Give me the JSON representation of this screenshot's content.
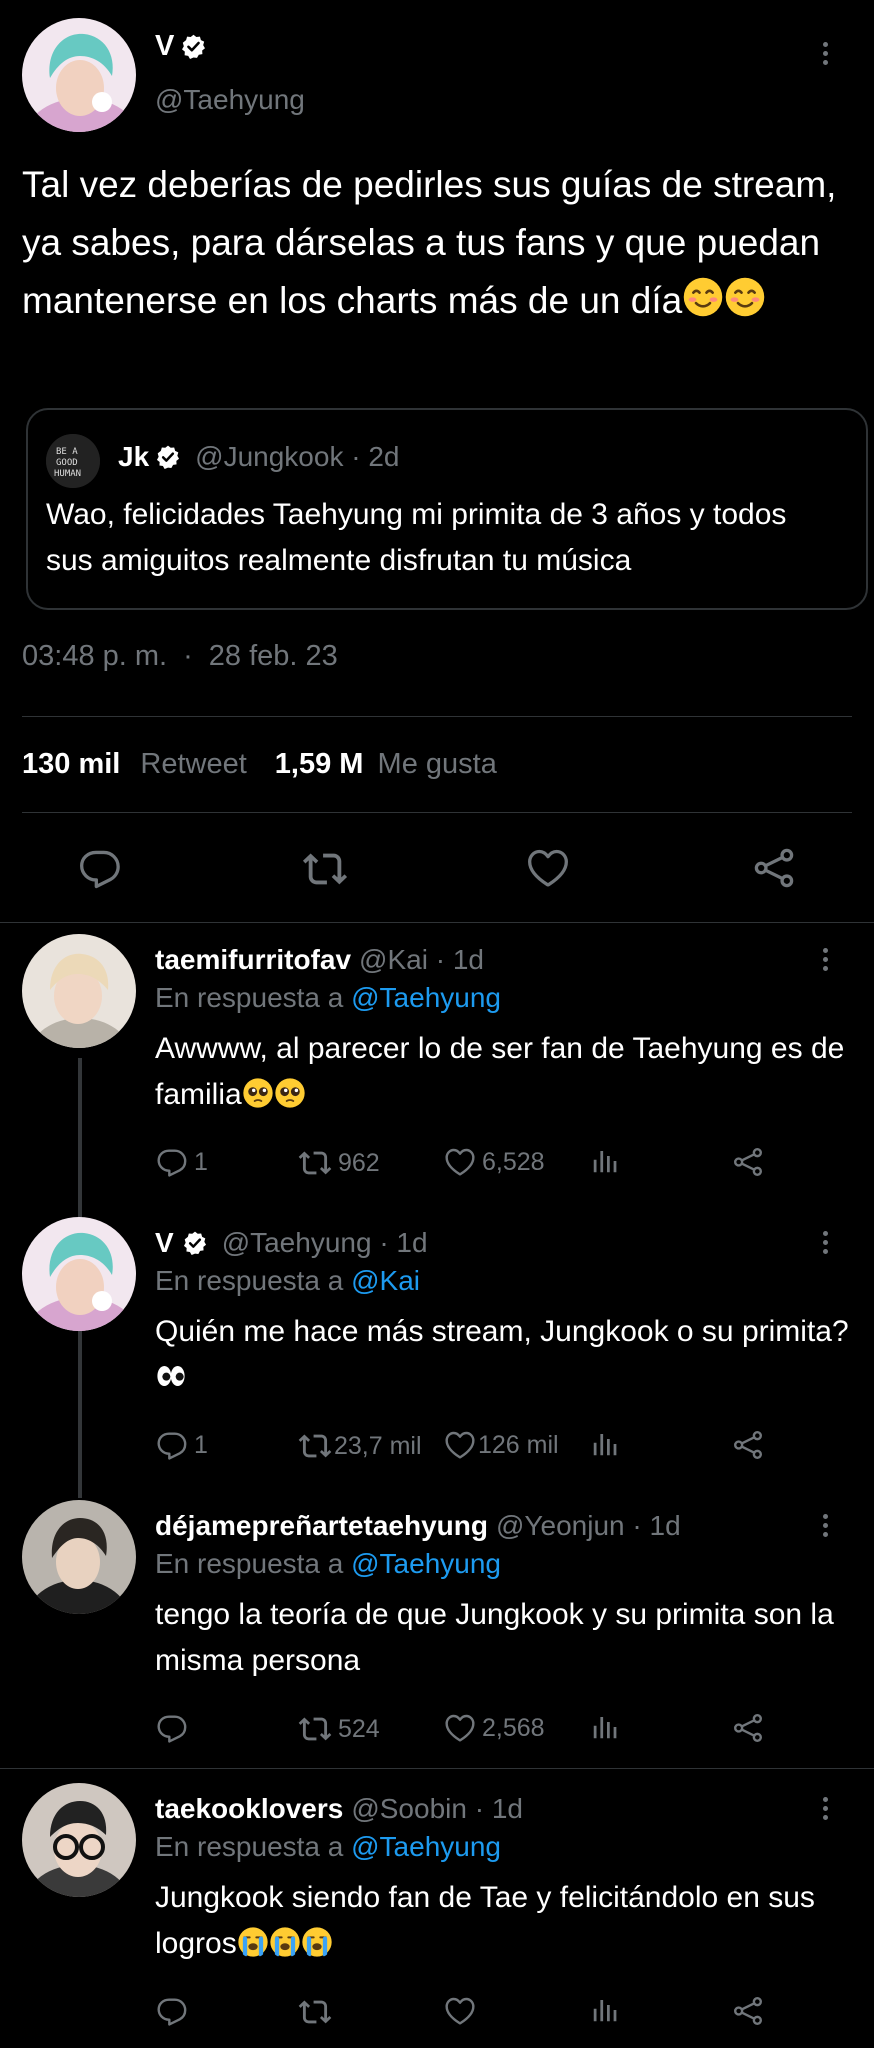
{
  "main_tweet": {
    "display_name": "V",
    "handle": "@Taehyung",
    "text": "Tal vez deberías de pedirles sus guías de stream, ya sabes, para dárselas a tus fans y que puedan mantenerse en los charts más de un día",
    "quoted": {
      "display_name": "Jk",
      "handle": "@Jungkook · 2d",
      "avatar_text": "BE A GOOD HUMAN",
      "text": "Wao, felicidades Taehyung mi primita de 3 años y todos sus amiguitos realmente disfrutan tu música"
    },
    "time": "03:48 p. m.",
    "sep": "·",
    "date": "28 feb. 23",
    "retweets_count": "130 mil",
    "retweets_label": "Retweet",
    "likes_count": "1,59 M",
    "likes_label": "Me gusta"
  },
  "replies": [
    {
      "display_name": "taemifurritofav",
      "meta": "@Kai · 1d",
      "reply_prefix": "En respuesta a",
      "reply_to": "@Taehyung",
      "text": "Awwww, al parecer lo de ser fan de Taehyung es de familia",
      "reply_count": "1",
      "retweet_count": "962",
      "like_count": "6,528"
    },
    {
      "display_name": "V",
      "meta": "@Taehyung · 1d",
      "reply_prefix": "En respuesta a",
      "reply_to": "@Kai",
      "text": "Quién me hace más stream, Jungkook o su primita?",
      "reply_count": "1",
      "retweet_count": "23,7 mil",
      "like_count": "126 mil"
    },
    {
      "display_name": "déjamepreñartetaehyung",
      "meta": "@Yeonjun · 1d",
      "reply_prefix": "En respuesta a",
      "reply_to": "@Taehyung",
      "text": "tengo la teoría de que Jungkook y su primita son la misma persona",
      "reply_count": "",
      "retweet_count": "524",
      "like_count": "2,568"
    },
    {
      "display_name": "taekooklovers",
      "meta": "@Soobin · 1d",
      "reply_prefix": "En respuesta a",
      "reply_to": "@Taehyung",
      "text": "Jungkook siendo fan de Tae y felicitándolo en sus logros",
      "reply_count": "",
      "retweet_count": "",
      "like_count": ""
    }
  ],
  "colors": {
    "accent": "#1d9bf0",
    "muted": "#71767b",
    "divider": "#2f3336",
    "background": "#000000",
    "text": "#e7e9ea"
  },
  "icons": [
    "reply-icon",
    "retweet-icon",
    "like-icon",
    "share-icon",
    "analytics-icon",
    "more-icon",
    "verified-badge-icon"
  ]
}
